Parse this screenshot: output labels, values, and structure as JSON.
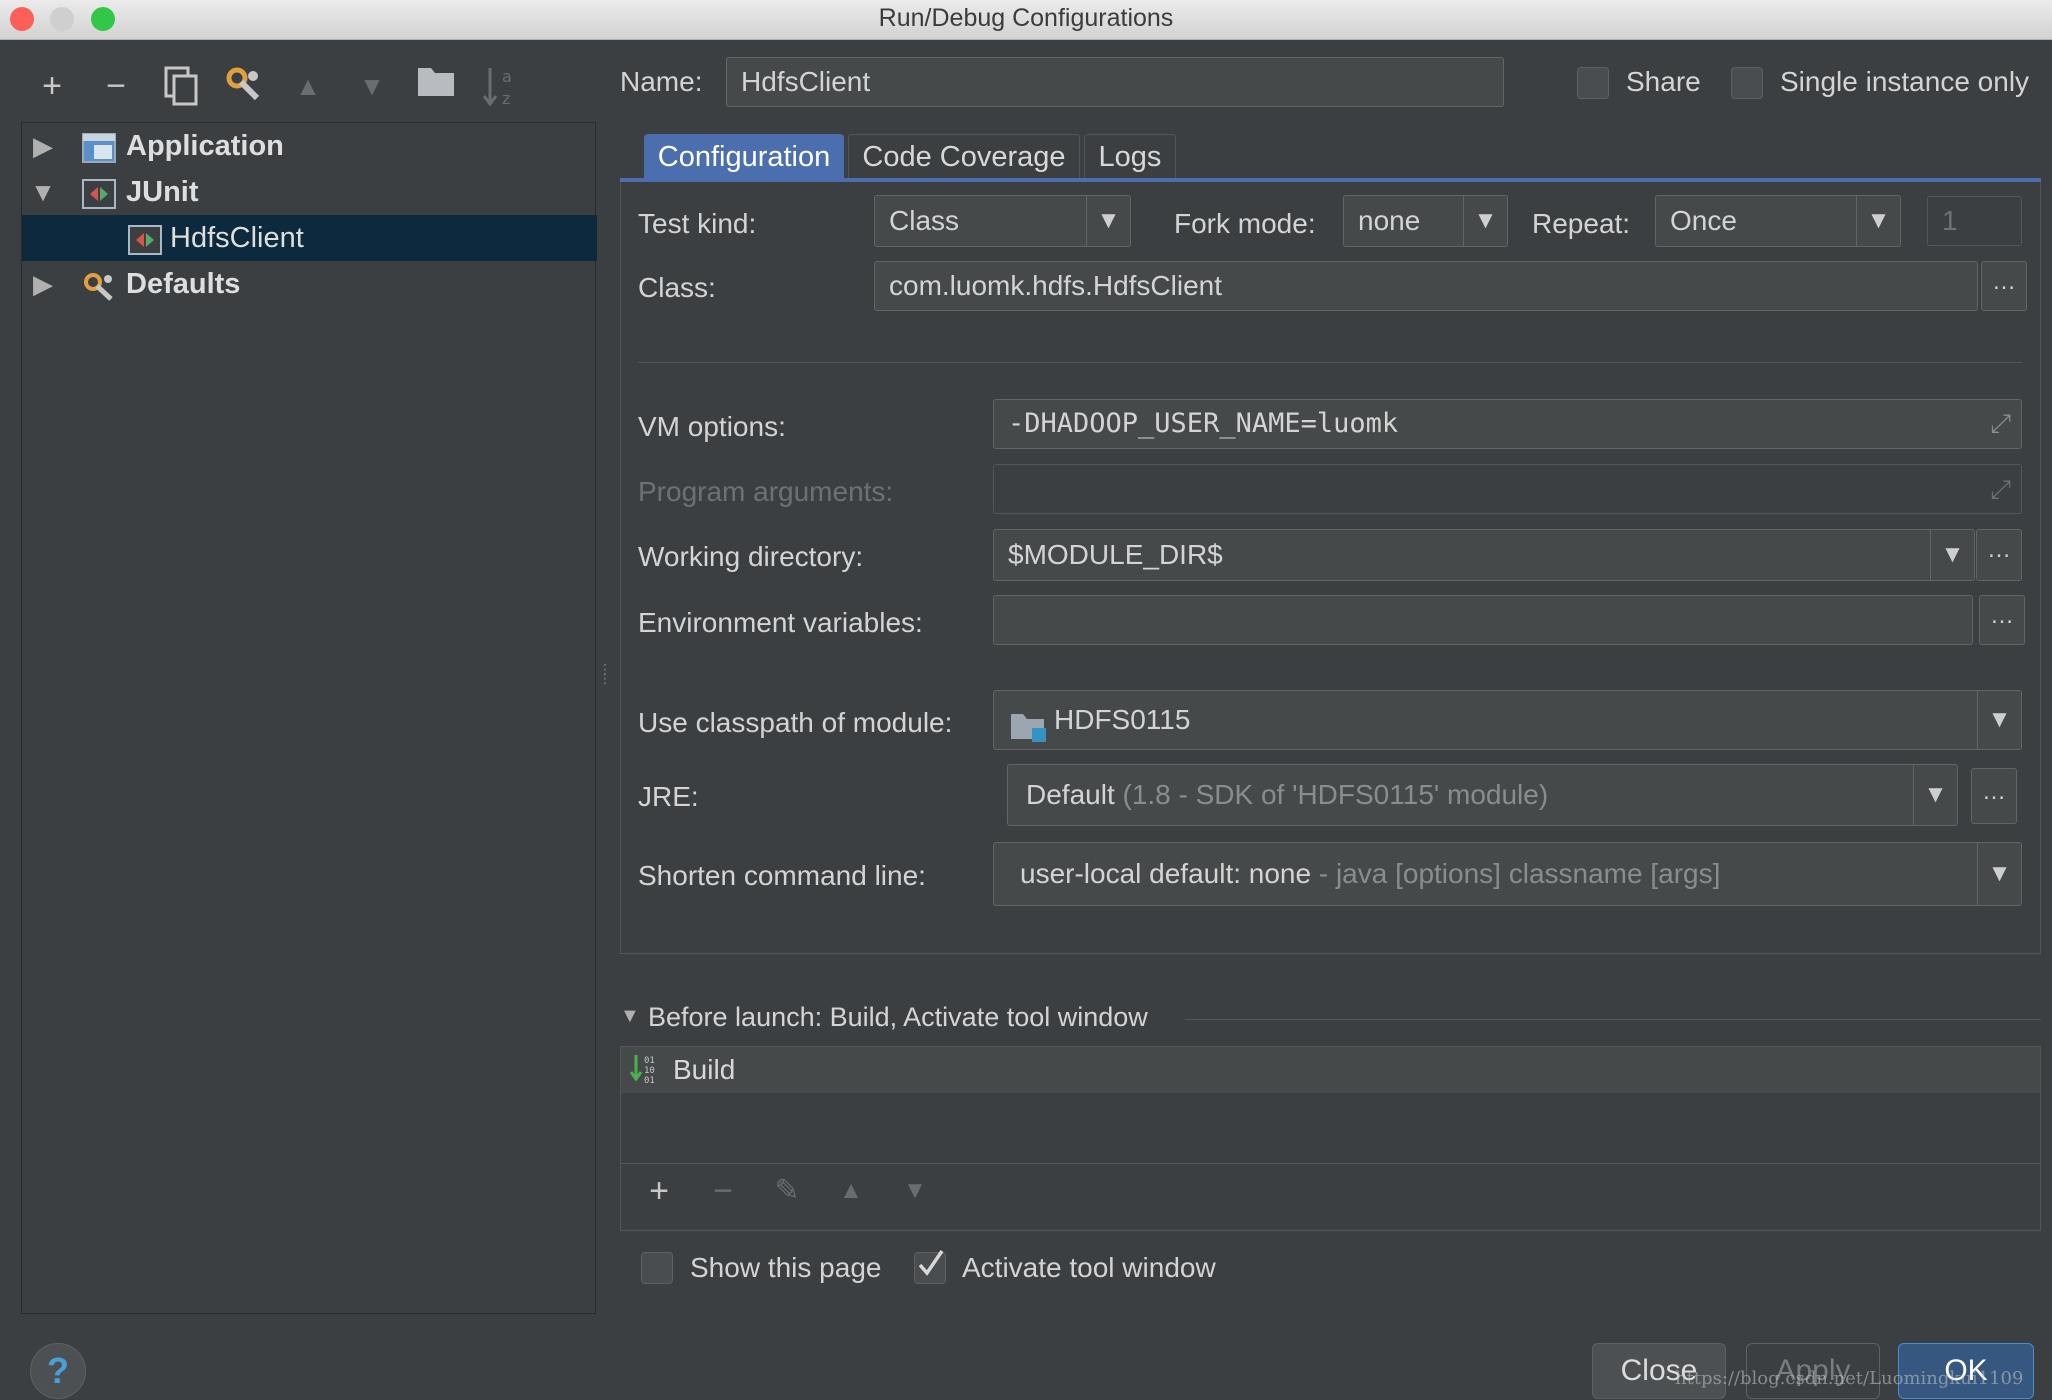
{
  "window": {
    "title": "Run/Debug Configurations"
  },
  "toolbar": {
    "icons": [
      "add-icon",
      "remove-icon",
      "copy-icon",
      "wrench-icon",
      "move-up-icon",
      "move-down-icon",
      "folder-icon",
      "sort-icon"
    ]
  },
  "tree": {
    "items": [
      {
        "label": "Application",
        "expanded": false,
        "level": 0
      },
      {
        "label": "JUnit",
        "expanded": true,
        "level": 0
      },
      {
        "label": "HdfsClient",
        "selected": true,
        "level": 1
      },
      {
        "label": "Defaults",
        "expanded": false,
        "level": 0
      }
    ]
  },
  "header": {
    "name_label": "Name:",
    "name_value": "HdfsClient",
    "share_label": "Share",
    "share_checked": false,
    "single_instance_label": "Single instance only",
    "single_instance_checked": false
  },
  "tabs": [
    {
      "label": "Configuration",
      "active": true
    },
    {
      "label": "Code Coverage",
      "active": false
    },
    {
      "label": "Logs",
      "active": false
    }
  ],
  "config": {
    "test_kind_label": "Test kind:",
    "test_kind_value": "Class",
    "fork_mode_label": "Fork mode:",
    "fork_mode_value": "none",
    "repeat_label": "Repeat:",
    "repeat_value": "Once",
    "repeat_count": "1",
    "class_label": "Class:",
    "class_value": "com.luomk.hdfs.HdfsClient",
    "vm_options_label": "VM options:",
    "vm_options_value": "-DHADOOP_USER_NAME=luomk",
    "program_args_label": "Program arguments:",
    "program_args_value": "",
    "working_dir_label": "Working directory:",
    "working_dir_value": "$MODULE_DIR$",
    "env_vars_label": "Environment variables:",
    "env_vars_value": "",
    "classpath_label": "Use classpath of module:",
    "classpath_value": "HDFS0115",
    "jre_label": "JRE:",
    "jre_value": "Default",
    "jre_detail": "(1.8 - SDK of 'HDFS0115' module)",
    "shorten_label": "Shorten command line:",
    "shorten_value": "user-local default: none",
    "shorten_detail": "- java [options] classname [args]"
  },
  "before_launch": {
    "title": "Before launch: Build, Activate tool window",
    "items": [
      {
        "label": "Build"
      }
    ],
    "toolbar_icons": [
      "add-icon",
      "remove-icon",
      "edit-icon",
      "move-up-icon",
      "move-down-icon"
    ],
    "show_page_label": "Show this page",
    "show_page_checked": false,
    "activate_label": "Activate tool window",
    "activate_checked": true
  },
  "buttons": {
    "close": "Close",
    "apply": "Apply",
    "ok": "OK"
  },
  "help": {
    "label": "?"
  },
  "watermark": "https://blog.csdn.net/Luomingkui1109",
  "colors": {
    "accent": "#4b6eaf",
    "selection": "#0d293e",
    "background": "#3c3f41"
  }
}
